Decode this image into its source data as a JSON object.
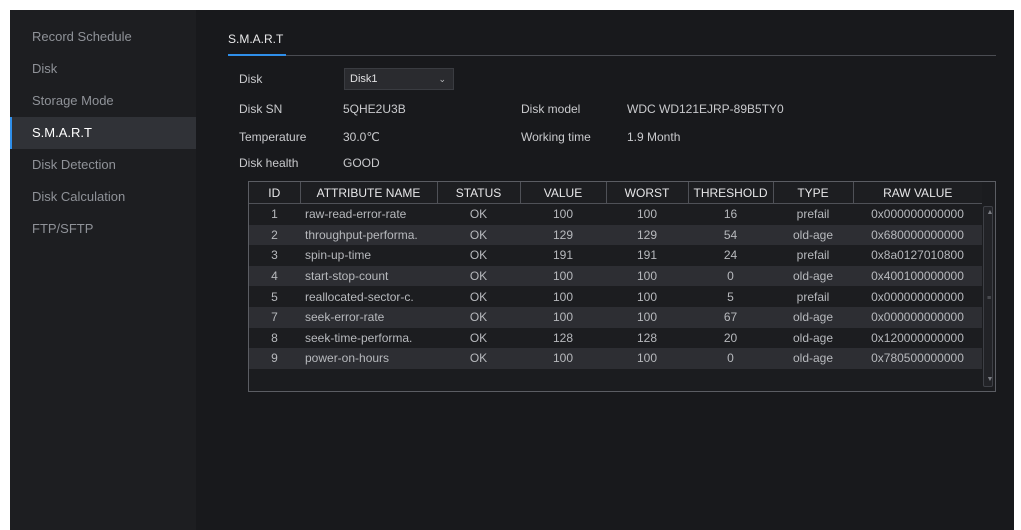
{
  "sidebar": {
    "items": [
      {
        "label": "Record Schedule",
        "active": false
      },
      {
        "label": "Disk",
        "active": false
      },
      {
        "label": "Storage Mode",
        "active": false
      },
      {
        "label": "S.M.A.R.T",
        "active": true
      },
      {
        "label": "Disk Detection",
        "active": false
      },
      {
        "label": "Disk Calculation",
        "active": false
      },
      {
        "label": "FTP/SFTP",
        "active": false
      }
    ]
  },
  "tab": {
    "label": "S.M.A.R.T"
  },
  "info": {
    "disk_label": "Disk",
    "disk_value": "Disk1",
    "disk_sn_label": "Disk SN",
    "disk_sn_value": "5QHE2U3B",
    "disk_model_label": "Disk model",
    "disk_model_value": "WDC WD121EJRP-89B5TY0",
    "temperature_label": "Temperature",
    "temperature_value": "30.0℃",
    "working_time_label": "Working time",
    "working_time_value": "1.9 Month",
    "disk_health_label": "Disk health",
    "disk_health_value": "GOOD"
  },
  "table": {
    "headers": [
      "ID",
      "ATTRIBUTE NAME",
      "STATUS",
      "VALUE",
      "WORST",
      "THRESHOLD",
      "TYPE",
      "RAW VALUE"
    ],
    "rows": [
      [
        "1",
        "raw-read-error-rate",
        "OK",
        "100",
        "100",
        "16",
        "prefail",
        "0x000000000000"
      ],
      [
        "2",
        "throughput-performa.",
        "OK",
        "129",
        "129",
        "54",
        "old-age",
        "0x680000000000"
      ],
      [
        "3",
        "spin-up-time",
        "OK",
        "191",
        "191",
        "24",
        "prefail",
        "0x8a0127010800"
      ],
      [
        "4",
        "start-stop-count",
        "OK",
        "100",
        "100",
        "0",
        "old-age",
        "0x400100000000"
      ],
      [
        "5",
        "reallocated-sector-c.",
        "OK",
        "100",
        "100",
        "5",
        "prefail",
        "0x000000000000"
      ],
      [
        "7",
        "seek-error-rate",
        "OK",
        "100",
        "100",
        "67",
        "old-age",
        "0x000000000000"
      ],
      [
        "8",
        "seek-time-performa.",
        "OK",
        "128",
        "128",
        "20",
        "old-age",
        "0x120000000000"
      ],
      [
        "9",
        "power-on-hours",
        "OK",
        "100",
        "100",
        "0",
        "old-age",
        "0x780500000000"
      ]
    ]
  },
  "colors": {
    "accent": "#2f8fea",
    "background": "#18191c",
    "sidebar": "#1d1e21"
  }
}
